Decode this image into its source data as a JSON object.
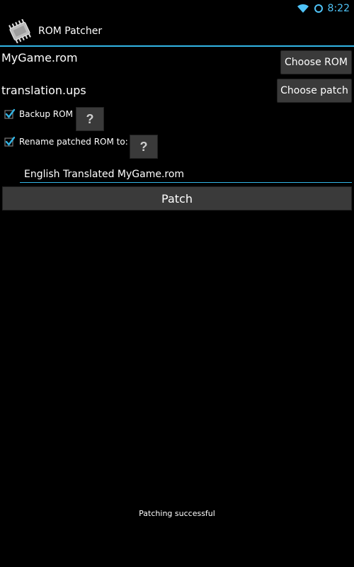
{
  "status_bar": {
    "time": "8:22",
    "icons": [
      "wifi-icon",
      "sync-icon"
    ],
    "accent_color": "#4fc3f7"
  },
  "action_bar": {
    "title": "ROM Patcher",
    "icon": "chip-icon",
    "divider_color": "#33b5e5"
  },
  "rom": {
    "file_name": "MyGame.rom",
    "button_label": "Choose ROM"
  },
  "patch": {
    "file_name": "translation.ups",
    "button_label": "Choose patch"
  },
  "options": {
    "backup": {
      "label": "Backup ROM",
      "checked": true,
      "help_label": "?"
    },
    "rename": {
      "label": "Rename patched ROM to:",
      "checked": true,
      "help_label": "?"
    }
  },
  "rename_input": {
    "value": "English Translated MyGame.rom"
  },
  "patch_button": {
    "label": "Patch"
  },
  "status_message": "Patching successful"
}
